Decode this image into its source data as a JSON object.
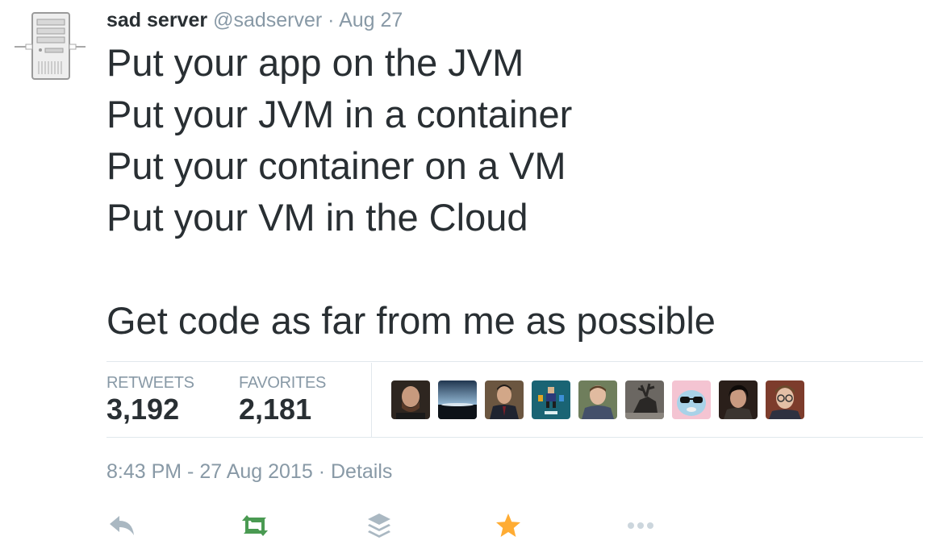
{
  "tweet": {
    "author_name": "sad server",
    "author_handle": "@sadserver",
    "separator": "·",
    "date": "Aug 27",
    "avatar_icon": "server-tower-icon",
    "lines": [
      "Put your app on the JVM",
      "Put your JVM in a container",
      "Put your container on a VM",
      "Put your VM in the Cloud",
      "",
      "Get code as far from me as possible"
    ]
  },
  "stats": {
    "retweets_label": "RETWEETS",
    "retweets_value": "3,192",
    "favorites_label": "FAVORITES",
    "favorites_value": "2,181"
  },
  "favoriters": [
    {
      "icon": "bald-bearded-man-avatar",
      "color": "#3a2a22"
    },
    {
      "icon": "sunset-landscape-avatar",
      "color": "#1c2a3a"
    },
    {
      "icon": "man-in-suit-avatar",
      "color": "#4a3a2e"
    },
    {
      "icon": "pixel-character-avatar",
      "color": "#1d5b6e"
    },
    {
      "icon": "man-outdoors-avatar",
      "color": "#5b6a4c"
    },
    {
      "icon": "elk-sculpture-avatar",
      "color": "#55524d"
    },
    {
      "icon": "cartoon-bird-sunglasses-avatar",
      "color": "#f2b9c9"
    },
    {
      "icon": "dark-haired-man-avatar",
      "color": "#2b211c"
    },
    {
      "icon": "man-with-glasses-avatar",
      "color": "#7a3b2a"
    }
  ],
  "footer": {
    "time": "8:43 PM - 27 Aug 2015",
    "separator": "·",
    "details_label": "Details"
  },
  "actions": {
    "reply_icon": "reply-icon",
    "retweet_icon": "retweet-icon",
    "buffer_icon": "buffer-stack-icon",
    "favorite_icon": "star-icon",
    "more_icon": "more-dots-icon"
  },
  "colors": {
    "text": "#292f33",
    "muted": "#8899a6",
    "divider": "#e1e8ed",
    "retweeted": "#19cf86",
    "retweet_green": "#4a9a52",
    "favorited": "#ffac33"
  }
}
